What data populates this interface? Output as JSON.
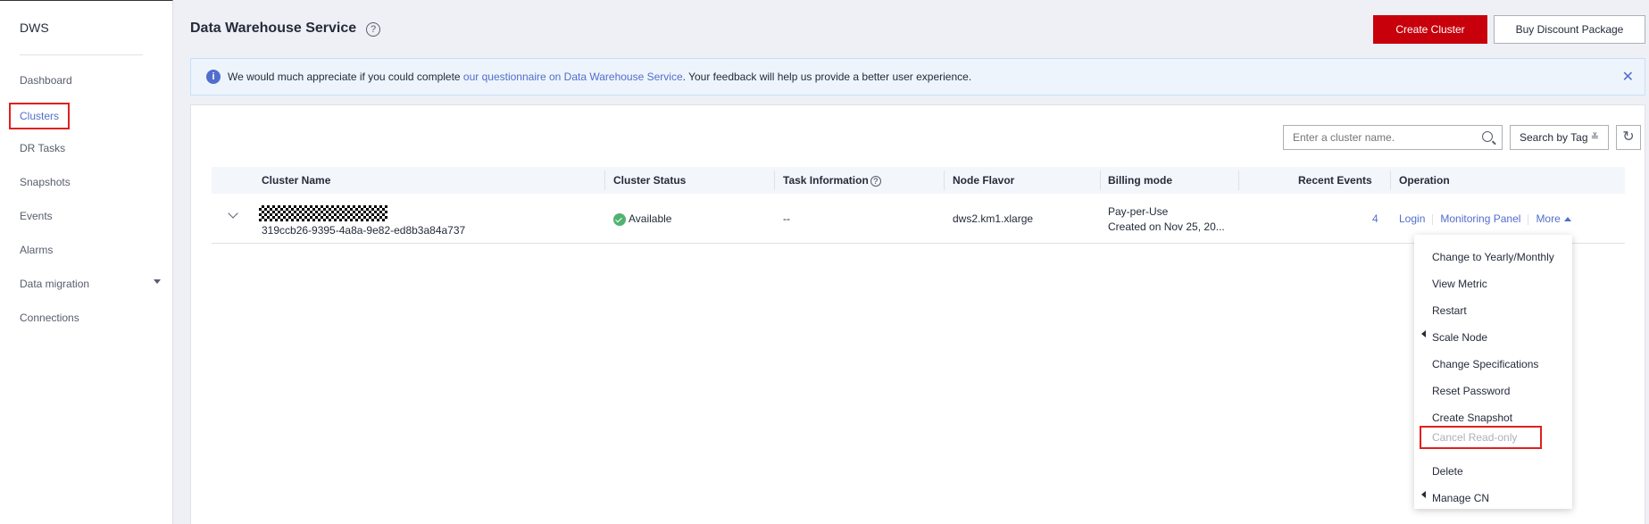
{
  "sidebar": {
    "brand": "DWS",
    "items": [
      {
        "label": "Dashboard"
      },
      {
        "label": "Clusters"
      },
      {
        "label": "DR Tasks"
      },
      {
        "label": "Snapshots"
      },
      {
        "label": "Events"
      },
      {
        "label": "Alarms"
      },
      {
        "label": "Data migration"
      },
      {
        "label": "Connections"
      }
    ]
  },
  "header": {
    "title": "Data Warehouse Service",
    "help_icon": "question-circle-icon",
    "create_button": "Create Cluster",
    "buy_button": "Buy Discount Package"
  },
  "notice": {
    "prefix": "We would much appreciate if you could complete ",
    "link": "our questionnaire on Data Warehouse Service",
    "suffix": ". Your feedback will help us provide a better user experience."
  },
  "toolbar": {
    "search_placeholder": "Enter a cluster name.",
    "tag_search": "Search by Tag"
  },
  "table": {
    "columns": [
      "Cluster Name",
      "Cluster Status",
      "Task Information",
      "Node Flavor",
      "Billing mode",
      "Recent Events",
      "Operation"
    ],
    "rows": [
      {
        "cluster_id": "319ccb26-9395-4a8a-9e82-ed8b3a84a737",
        "status": "Available",
        "task_info": "--",
        "node_flavor": "dws2.km1.xlarge",
        "billing_mode": "Pay-per-Use",
        "created": "Created on Nov 25, 20...",
        "recent_events": "4",
        "ops": {
          "login": "Login",
          "monitoring": "Monitoring Panel",
          "more": "More"
        }
      }
    ]
  },
  "more_menu": [
    "Change to Yearly/Monthly",
    "View Metric",
    "Restart",
    "Scale Node",
    "Change Specifications",
    "Reset Password",
    "Create Snapshot",
    "Cancel Read-only",
    "Delete",
    "Manage CN"
  ],
  "colors": {
    "primary": "#c7000b",
    "link": "#526ecc",
    "success": "#50b371",
    "highlight": "#e02020"
  }
}
